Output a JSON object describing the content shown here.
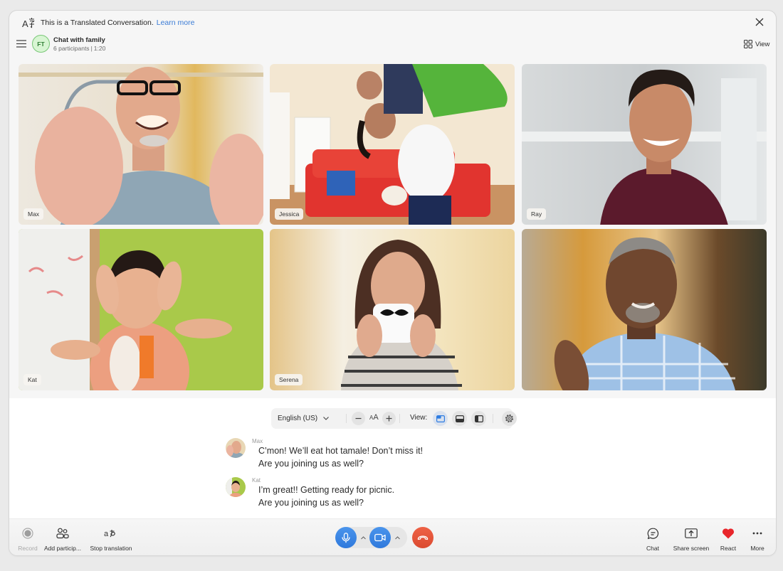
{
  "banner": {
    "text": "This is a Translated Conversation.",
    "link": "Learn more",
    "icon": "translate-icon"
  },
  "header": {
    "avatar_initials": "FT",
    "title": "Chat with family",
    "participants": "6 participants",
    "separator": "|",
    "duration": "1:20",
    "view_label": "View"
  },
  "participants": [
    {
      "name": "Max"
    },
    {
      "name": "Jessica"
    },
    {
      "name": "Ray"
    },
    {
      "name": "Kat"
    },
    {
      "name": "Serena"
    },
    {
      "name": ""
    }
  ],
  "captions_toolbar": {
    "language": "English (US)",
    "font_size_small": "A",
    "font_size_large": "A",
    "view_label": "View:",
    "view_options": [
      "overlay",
      "bottom-panel",
      "side-panel"
    ],
    "active_view": "overlay"
  },
  "captions": [
    {
      "speaker": "Max",
      "lines": [
        "C’mon! We’ll eat hot tamale! Don’t miss it!",
        "Are you joining us as well?"
      ]
    },
    {
      "speaker": "Kat",
      "lines": [
        "I’m great!! Getting ready for picnic.",
        "Are you joining us as well?"
      ]
    }
  ],
  "toolbar": {
    "left": [
      {
        "label": "Record",
        "icon": "record-icon",
        "enabled": false
      },
      {
        "label": "Add particip...",
        "icon": "add-participants-icon",
        "enabled": true
      },
      {
        "label": "Stop translation",
        "icon": "translate-icon",
        "enabled": true
      }
    ],
    "center": {
      "mic": "microphone-icon",
      "camera": "camera-icon",
      "end_call": "end-call-icon"
    },
    "right": [
      {
        "label": "Chat",
        "icon": "chat-icon"
      },
      {
        "label": "Share screen",
        "icon": "share-screen-icon"
      },
      {
        "label": "React",
        "icon": "heart-icon"
      },
      {
        "label": "More",
        "icon": "more-icon"
      }
    ]
  },
  "colors": {
    "accent": "#2f7de1",
    "link": "#3a7bd5",
    "end_call": "#e4533a",
    "react": "#e8262b",
    "avatar_bg": "#d8f5d3",
    "avatar_text": "#2f7d33"
  }
}
